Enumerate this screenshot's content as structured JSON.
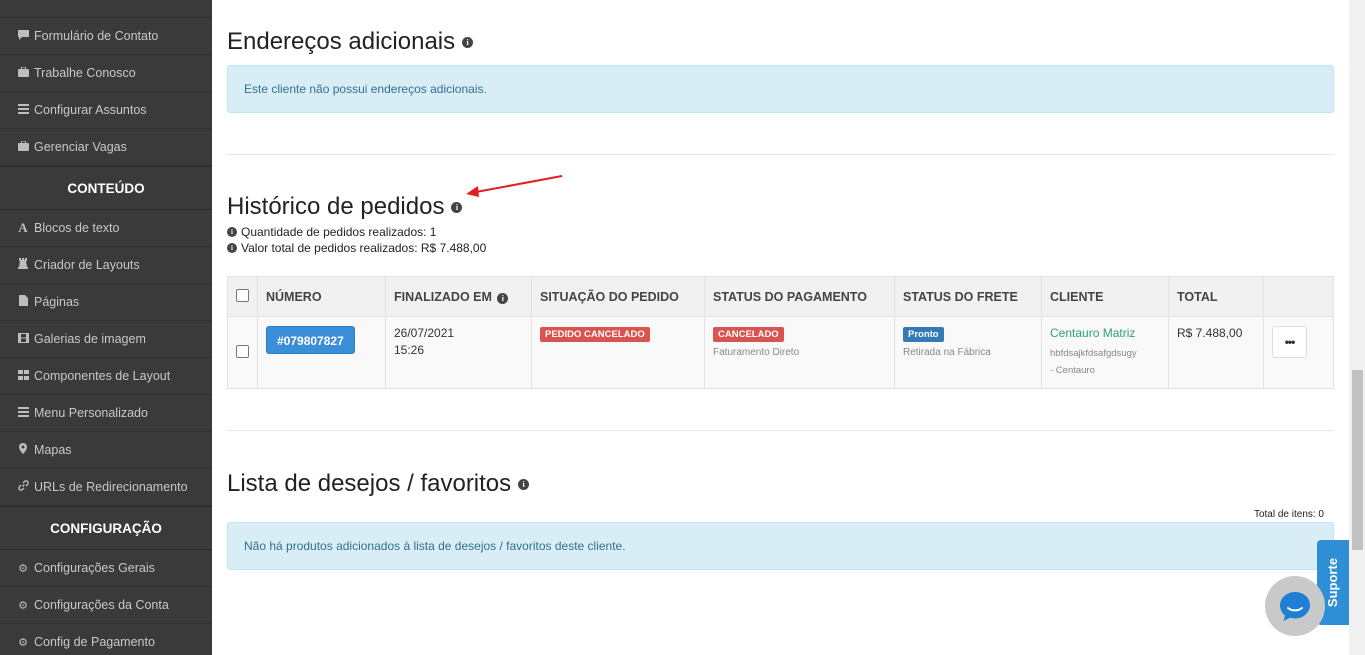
{
  "sidebar": {
    "items_top": [
      {
        "label": "Formulário de Contato",
        "icon": "comment-icon"
      },
      {
        "label": "Trabalhe Conosco",
        "icon": "briefcase-icon"
      },
      {
        "label": "Configurar Assuntos",
        "icon": "list-icon"
      },
      {
        "label": "Gerenciar Vagas",
        "icon": "briefcase-icon"
      }
    ],
    "section_content": "CONTEÚDO",
    "items_content": [
      {
        "label": "Blocos de texto",
        "icon": "font-icon"
      },
      {
        "label": "Criador de Layouts",
        "icon": "chess-rook-icon"
      },
      {
        "label": "Páginas",
        "icon": "file-icon"
      },
      {
        "label": "Galerias de imagem",
        "icon": "film-icon"
      },
      {
        "label": "Componentes de Layout",
        "icon": "grid-icon"
      },
      {
        "label": "Menu Personalizado",
        "icon": "list-icon"
      },
      {
        "label": "Mapas",
        "icon": "map-marker-icon"
      },
      {
        "label": "URLs de Redirecionamento",
        "icon": "link-icon"
      }
    ],
    "section_config": "CONFIGURAÇÃO",
    "items_config": [
      {
        "label": "Configurações Gerais",
        "icon": "gear-icon"
      },
      {
        "label": "Configurações da Conta",
        "icon": "gear-icon"
      },
      {
        "label": "Config de Pagamento",
        "icon": "gear-icon"
      }
    ]
  },
  "addresses": {
    "title": "Endereços adicionais",
    "alert": "Este cliente não possui endereços adicionais."
  },
  "orders": {
    "title": "Histórico de pedidos",
    "count_line": "Quantidade de pedidos realizados: 1",
    "total_line": "Valor total de pedidos realizados: R$ 7.488,00",
    "headers": [
      "NÚMERO",
      "FINALIZADO EM",
      "SITUAÇÃO DO PEDIDO",
      "STATUS DO PAGAMENTO",
      "STATUS DO FRETE",
      "CLIENTE",
      "TOTAL"
    ],
    "rows": [
      {
        "number": "#079807827",
        "date": "26/07/2021",
        "time": "15:26",
        "order_status": "PEDIDO CANCELADO",
        "payment_status": "CANCELADO",
        "payment_method": "Faturamento Direto",
        "shipping_status": "Pronto",
        "shipping_method": "Retirada na Fábrica",
        "client_name": "Centauro Matriz",
        "client_detail_1": "hbfdsajkfdsafgdsugy",
        "client_detail_2": "- Centauro",
        "total": "R$ 7.488,00",
        "more": "•••"
      }
    ]
  },
  "wishlist": {
    "title": "Lista de desejos / favoritos",
    "total_items": "Total de itens: 0",
    "alert": "Não há produtos adicionados à lista de desejos / favoritos deste cliente."
  },
  "support": {
    "label": "Suporte"
  },
  "colors": {
    "sidebar_bg": "#3a3a3a",
    "accent_blue": "#3a8fd8",
    "danger": "#d9534f",
    "client_green": "#2aa56f",
    "annotation_arrow": "#e02020"
  }
}
